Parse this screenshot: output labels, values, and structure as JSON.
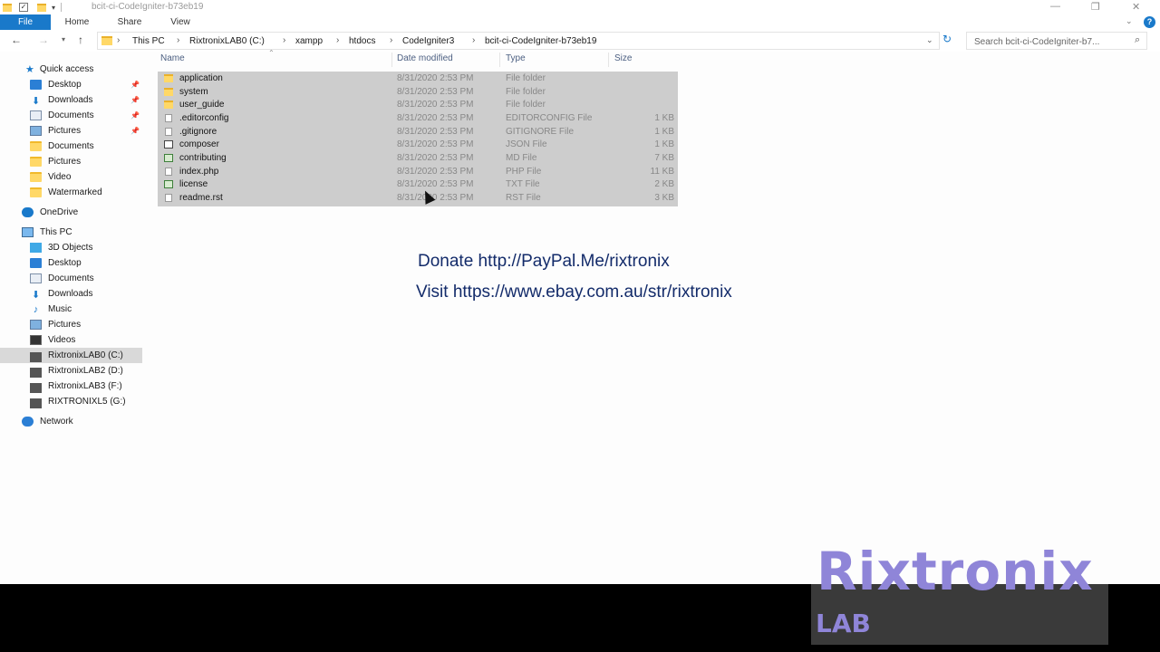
{
  "window": {
    "title": "bcit-ci-CodeIgniter-b73eb19",
    "controls": {
      "minimize": "—",
      "restore": "❐",
      "close": "✕"
    }
  },
  "ribbon": {
    "tabs": [
      "File",
      "Home",
      "Share",
      "View"
    ]
  },
  "address": {
    "crumbs": [
      "This PC",
      "RixtronixLAB0 (C:)",
      "xampp",
      "htdocs",
      "CodeIgniter3",
      "bcit-ci-CodeIgniter-b73eb19"
    ],
    "search_placeholder": "Search bcit-ci-CodeIgniter-b7..."
  },
  "nav": {
    "quick_access": "Quick access",
    "quick_items": [
      "Desktop",
      "Downloads",
      "Documents",
      "Pictures",
      "Documents",
      "Pictures",
      "Video",
      "Watermarked"
    ],
    "onedrive": "OneDrive",
    "this_pc": "This PC",
    "pc_items": [
      "3D Objects",
      "Desktop",
      "Documents",
      "Downloads",
      "Music",
      "Pictures",
      "Videos",
      "RixtronixLAB0 (C:)",
      "RixtronixLAB2 (D:)",
      "RixtronixLAB3 (F:)",
      "RIXTRONIXL5 (G:)"
    ],
    "network": "Network"
  },
  "columns": {
    "name": "Name",
    "date": "Date modified",
    "type": "Type",
    "size": "Size"
  },
  "files": [
    {
      "name": "application",
      "date": "8/31/2020 2:53 PM",
      "type": "File folder",
      "size": ""
    },
    {
      "name": "system",
      "date": "8/31/2020 2:53 PM",
      "type": "File folder",
      "size": ""
    },
    {
      "name": "user_guide",
      "date": "8/31/2020 2:53 PM",
      "type": "File folder",
      "size": ""
    },
    {
      "name": ".editorconfig",
      "date": "8/31/2020 2:53 PM",
      "type": "EDITORCONFIG File",
      "size": "1 KB"
    },
    {
      "name": ".gitignore",
      "date": "8/31/2020 2:53 PM",
      "type": "GITIGNORE File",
      "size": "1 KB"
    },
    {
      "name": "composer",
      "date": "8/31/2020 2:53 PM",
      "type": "JSON File",
      "size": "1 KB"
    },
    {
      "name": "contributing",
      "date": "8/31/2020 2:53 PM",
      "type": "MD File",
      "size": "7 KB"
    },
    {
      "name": "index.php",
      "date": "8/31/2020 2:53 PM",
      "type": "PHP File",
      "size": "11 KB"
    },
    {
      "name": "license",
      "date": "8/31/2020 2:53 PM",
      "type": "TXT File",
      "size": "2 KB"
    },
    {
      "name": "readme.rst",
      "date": "8/31/2020 2:53 PM",
      "type": "RST File",
      "size": "3 KB"
    }
  ],
  "overlay": {
    "donate": "Donate http://PayPal.Me/rixtronix",
    "visit": "Visit https://www.ebay.com.au/str/rixtronix"
  },
  "watermark": {
    "brand": "Rixtronix",
    "sub": "LAB"
  },
  "colors": {
    "accent": "#1979ca",
    "selection": "#cdcdcd",
    "watermark": "#8f85d8",
    "overlay_text": "#132b6a"
  }
}
